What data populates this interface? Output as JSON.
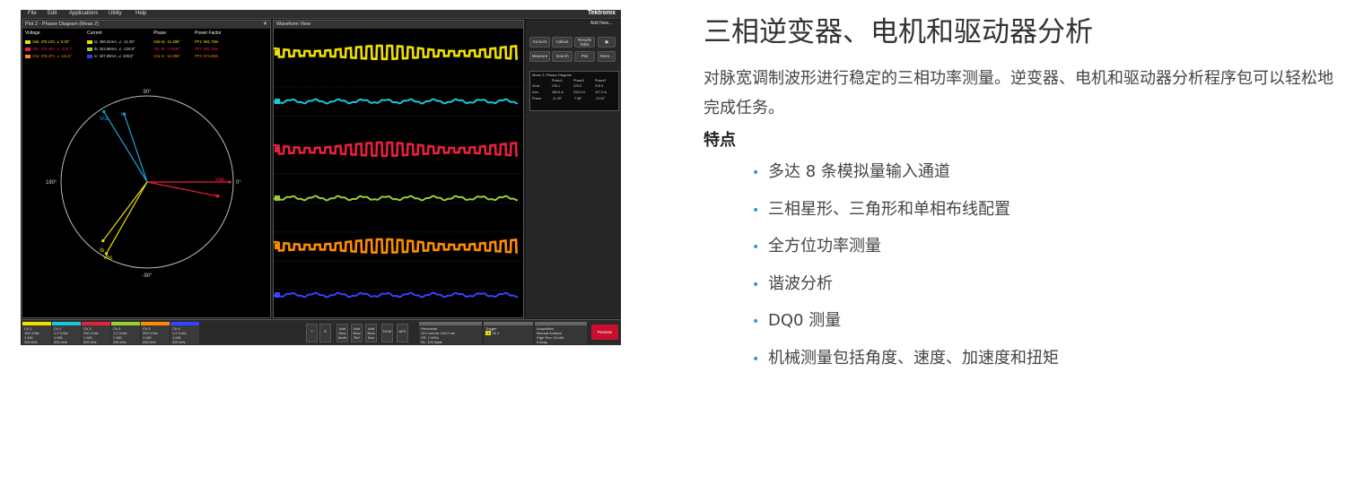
{
  "scope": {
    "menu": [
      "File",
      "Edit",
      "Applications",
      "Utility",
      "Help"
    ],
    "brand": "Tektronix",
    "plot_title": "Plot 2 - Phasor Diagram (Meas 2)",
    "close_glyph": "✕",
    "table_headers": [
      "Voltage",
      "Current",
      "Phase",
      "Power Factor"
    ],
    "table_rows": [
      {
        "color": "#f0e000",
        "voltage": "Vab: 378.12V, ∠ 0.00°",
        "ichip": "#f0e000",
        "current": "Ia: 380.61mA, ∠ -11.39°",
        "phase": "Vab-Ia: -11.396°",
        "pf": "PF1: 981.78m"
      },
      {
        "color": "#e8213a",
        "voltage": "Vbc: 378.46V, ∠ -119.7°",
        "ichip": "#9ad030",
        "current": "Ib: 343.88mA, ∠ -126.9°",
        "phase": "Vbc-Ib: -7.5830°",
        "pf": "PF2: 991.26m"
      },
      {
        "color": "#ff8c00",
        "voltage": "Vca: 378.47V, ∠ 121.6°",
        "ichip": "#3040e0",
        "current": "Ic: 347.90mA, ∠ 108.6°",
        "phase": "Vca-Ic: -12.998°",
        "pf": "PF3: 974.36m"
      }
    ],
    "phasor_labels": {
      "top": "90°",
      "bottom": "-90°",
      "left": "180°",
      "right": "0°"
    },
    "phasor_vectors": [
      "Vab",
      "Ia",
      "Vbc",
      "Ib",
      "Vca",
      "Ic"
    ],
    "wave_title": "Waveform View",
    "wave_colors": [
      "#f0e000",
      "#19c8d8",
      "#e8213a",
      "#9ad030",
      "#ff8c00",
      "#3344ff"
    ],
    "add_new": "Add New...",
    "right_buttons": [
      "Cursors",
      "Callout",
      "Results Table",
      "Measure",
      "Search",
      "Plot",
      "More..."
    ],
    "meas_title": "Meas 2: Phasor Diagram",
    "meas_cols": [
      "Phase1",
      "Phase2",
      "Phase3"
    ],
    "meas_rows": [
      {
        "label": "Vrms",
        "v": [
          "378.1",
          "378.5",
          "378.5"
        ]
      },
      {
        "label": "Irms",
        "v": [
          "380.6 m",
          "343.9 m",
          "347.9 m"
        ]
      },
      {
        "label": "Phase",
        "v": [
          "-11.39°",
          "-7.58°",
          "-13.00°"
        ]
      }
    ],
    "channels": [
      {
        "name": "Ch 1",
        "l1": "100 V/div",
        "l2": "1 MΩ",
        "l3": "200 kHz",
        "color": "#f0e000"
      },
      {
        "name": "Ch 2",
        "l1": "1.2 V/div",
        "l2": "1 MΩ",
        "l3": "200 kHz",
        "color": "#19c8d8"
      },
      {
        "name": "Ch 3",
        "l1": "200 V/div",
        "l2": "1 MΩ",
        "l3": "200 kHz",
        "color": "#e8213a"
      },
      {
        "name": "Ch 4",
        "l1": "1.2 V/div",
        "l2": "1 MΩ",
        "l3": "200 kHz",
        "color": "#9ad030"
      },
      {
        "name": "Ch 5",
        "l1": "200 V/div",
        "l2": "1 MΩ",
        "l3": "200 kHz",
        "color": "#ff8c00"
      },
      {
        "name": "Ch 6",
        "l1": "1.2 V/div",
        "l2": "1 MΩ",
        "l3": "200 kHz",
        "color": "#3344ff"
      }
    ],
    "bottom_buttons": [
      "7",
      "8",
      "Add New Math",
      "Add New Ref",
      "Add New Bus",
      "DVM",
      "AFG"
    ],
    "horizontal": [
      "Horizontal",
      "10.0 ms/div  100.0 ms",
      "SR: 1 MS/s",
      "RL: 100 Mpts"
    ],
    "trigger": [
      "Trigger",
      "1",
      "25 V"
    ],
    "acquisition": [
      "Acquisition",
      "Manual   Analyze",
      "High Res: 16 bits",
      "0 Acqs"
    ],
    "preview": "Preview"
  },
  "heading": "三相逆变器、电机和驱动器分析",
  "intro": "对脉宽调制波形进行稳定的三相功率测量。逆变器、电机和驱动器分析程序包可以轻松地完成任务。",
  "features_title": "特点",
  "bullet_glyph": "•",
  "features": [
    "多达 8 条模拟量输入通道",
    "三相星形、三角形和单相布线配置",
    "全方位功率测量",
    "谐波分析",
    "DQ0 测量",
    "机械测量包括角度、速度、加速度和扭矩"
  ]
}
